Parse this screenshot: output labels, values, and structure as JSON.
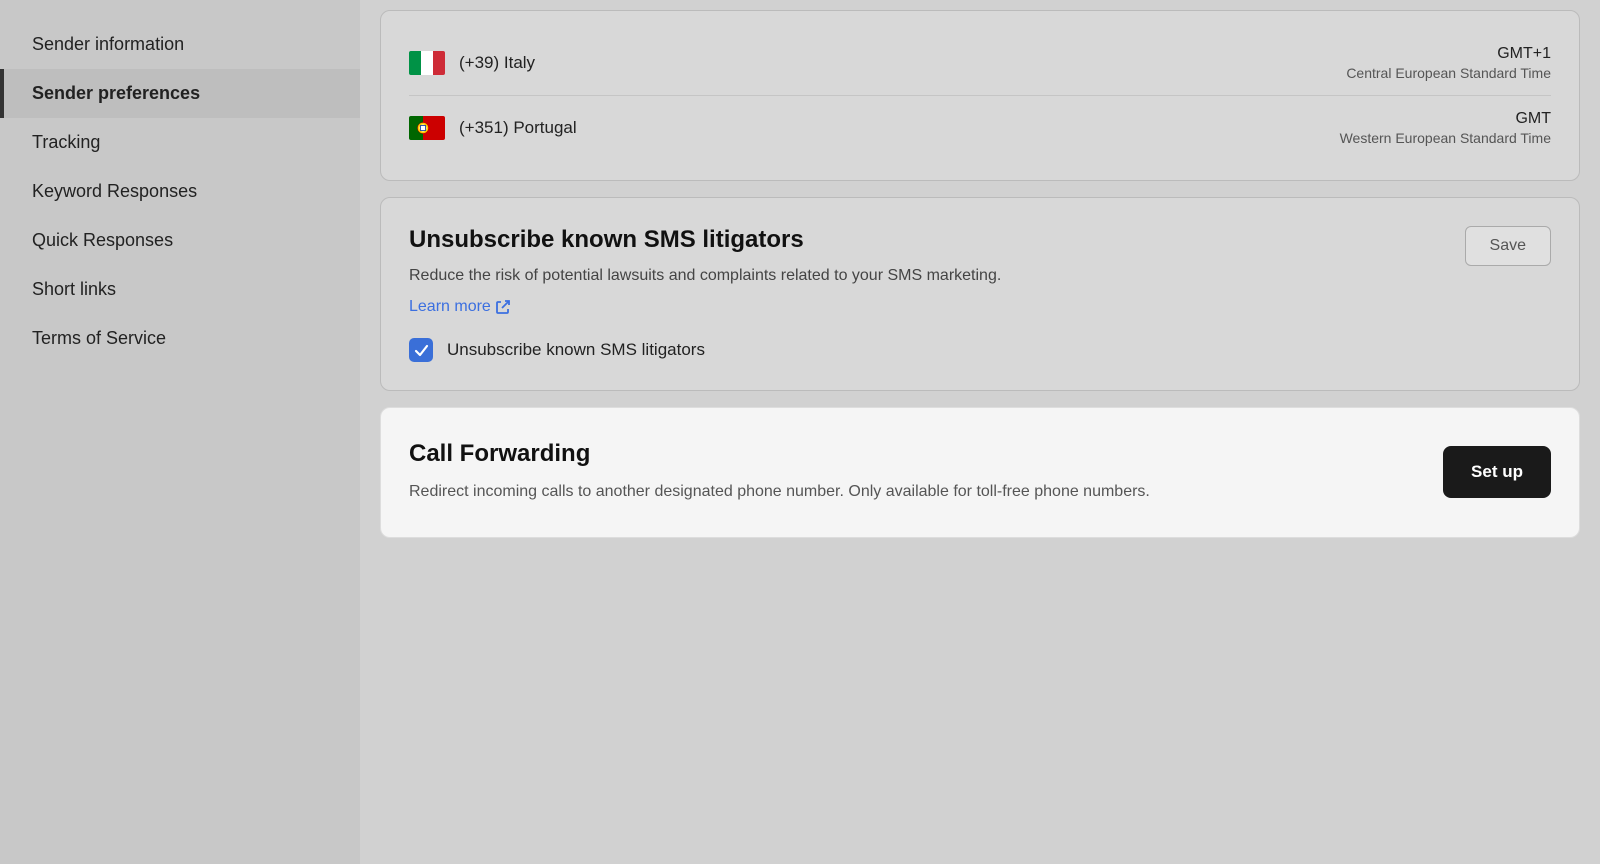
{
  "sidebar": {
    "items": [
      {
        "id": "sender-information",
        "label": "Sender information",
        "active": false
      },
      {
        "id": "sender-preferences",
        "label": "Sender preferences",
        "active": true
      },
      {
        "id": "tracking",
        "label": "Tracking",
        "active": false
      },
      {
        "id": "keyword-responses",
        "label": "Keyword Responses",
        "active": false
      },
      {
        "id": "quick-responses",
        "label": "Quick Responses",
        "active": false
      },
      {
        "id": "short-links",
        "label": "Short links",
        "active": false
      },
      {
        "id": "terms-of-service",
        "label": "Terms of Service",
        "active": false
      }
    ]
  },
  "countries": [
    {
      "flag": "italy",
      "dial_code": "(+39) Italy",
      "timezone_code": "GMT+1",
      "timezone_name": "Central European Standard Time"
    },
    {
      "flag": "portugal",
      "dial_code": "(+351) Portugal",
      "timezone_code": "GMT",
      "timezone_name": "Western European Standard Time"
    }
  ],
  "unsubscribe_section": {
    "title": "Unsubscribe known SMS litigators",
    "description": "Reduce the risk of potential lawsuits and complaints related to your SMS marketing.",
    "learn_more_label": "Learn more",
    "save_label": "Save",
    "checkbox_label": "Unsubscribe known SMS litigators",
    "checked": true
  },
  "call_forwarding": {
    "title": "Call Forwarding",
    "description": "Redirect incoming calls to another designated phone number. Only available for toll-free phone numbers.",
    "setup_label": "Set up"
  }
}
